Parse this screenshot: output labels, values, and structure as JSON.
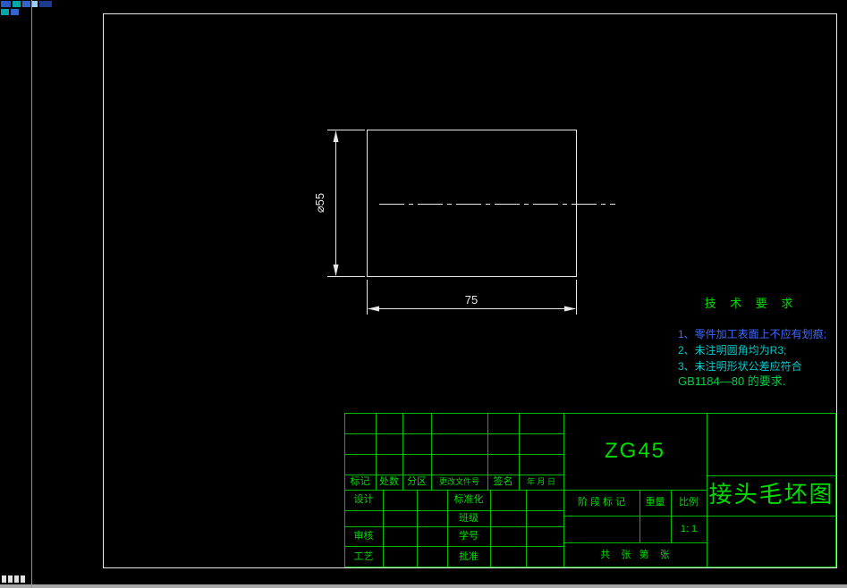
{
  "colors": {
    "background": "#000000",
    "geometry_white": "#e8e8e8",
    "table_lines_green": "#00bb00",
    "table_text_green": "#00dd00",
    "paper_edge_cyan": "#00d0d0",
    "tech_title_green": "#00dd00",
    "tech_line1_blue": "#4169ff",
    "tech_line23_cyan": "#00cccc",
    "tech_line4_green": "#00cc44"
  },
  "drawing": {
    "dim_vertical": "⌀55",
    "dim_horizontal": "75"
  },
  "tech_requirements": {
    "title": "技 术 要 求",
    "lines": [
      "1、零件加工表面上不应有划痕;",
      "2、未注明圆角均为R3;",
      "3、未注明形状公差应符合",
      "GB1184—80 的要求."
    ]
  },
  "title_block": {
    "material": "ZG45",
    "drawing_name": "接头毛坯图",
    "header": {
      "mark": "标记",
      "count": "处数",
      "zone": "分区",
      "change_file": "更改文件号",
      "sign": "签名",
      "date": "年 月 日"
    },
    "roles": {
      "design": "设计",
      "standardize": "标准化",
      "class": "班级",
      "audit": "审核",
      "student_no": "学号",
      "process": "工艺",
      "approve": "批准"
    },
    "stage_mark": "阶 段 标 记",
    "weight": "重量",
    "scale": "比例",
    "scale_value": "1: 1",
    "sheets": "共    张   第    张"
  }
}
